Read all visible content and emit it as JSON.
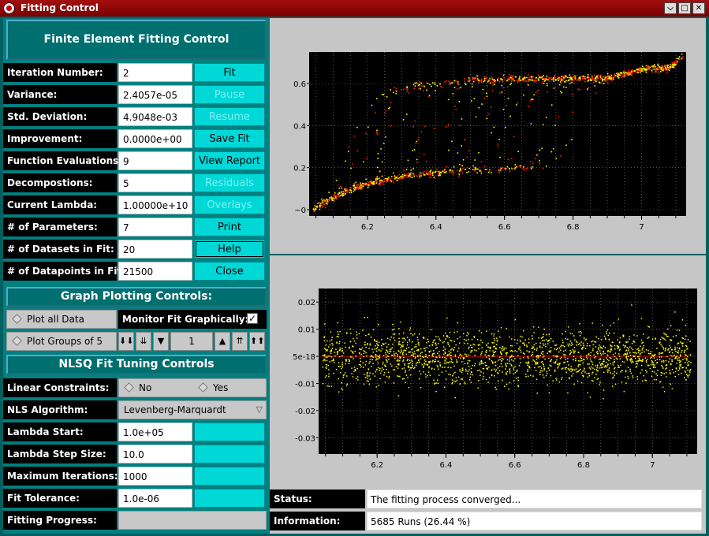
{
  "window": {
    "title": "Fitting Control"
  },
  "header": {
    "title": "Finite Element Fitting Control"
  },
  "stats": [
    {
      "label": "Iteration Number:",
      "value": "2",
      "button": "Fit",
      "enabled": true
    },
    {
      "label": "Variance:",
      "value": "2.4057e-05",
      "button": "Pause",
      "enabled": false
    },
    {
      "label": "Std. Deviation:",
      "value": "4.9048e-03",
      "button": "Resume",
      "enabled": false
    },
    {
      "label": "Improvement:",
      "value": "0.0000e+00",
      "button": "Save Fit",
      "enabled": true
    },
    {
      "label": "Function Evaluations:",
      "value": "9",
      "button": "View Report",
      "enabled": true
    },
    {
      "label": "Decompostions:",
      "value": "5",
      "button": "Residuals",
      "enabled": false
    },
    {
      "label": "Current Lambda:",
      "value": "1.00000e+10",
      "button": "Overlays",
      "enabled": false
    },
    {
      "label": "# of Parameters:",
      "value": "7",
      "button": "Print",
      "enabled": true
    },
    {
      "label": "# of Datasets in Fit:",
      "value": "20",
      "button": "Help",
      "enabled": true
    },
    {
      "label": "# of Datapoints in Fit:",
      "value": "21500",
      "button": "Close",
      "enabled": true
    }
  ],
  "graph_controls": {
    "title": "Graph Plotting Controls:",
    "plot_all": "Plot all Data",
    "plot_groups": "Plot Groups of 5",
    "monitor_label": "Monitor Fit Graphically:",
    "monitor_checked": true,
    "group_value": "1"
  },
  "nlsq": {
    "title": "NLSQ Fit Tuning Controls",
    "linear_constraints_label": "Linear Constraints:",
    "no_label": "No",
    "yes_label": "Yes",
    "algorithm_label": "NLS Algorithm:",
    "algorithm_value": "Levenberg-Marquardt",
    "lambda_start_label": "Lambda Start:",
    "lambda_start_value": "1.0e+05",
    "lambda_step_label": "Lambda Step Size:",
    "lambda_step_value": "10.0",
    "max_iter_label": "Maximum Iterations:",
    "max_iter_value": "1000",
    "fit_tol_label": "Fit Tolerance:",
    "fit_tol_value": "1.0e-06",
    "progress_label": "Fitting Progress:",
    "progress": 0
  },
  "status": {
    "status_label": "Status:",
    "status_value": "The fitting process converged...",
    "info_label": "Information:",
    "info_value": "5685 Runs (26.44 %)"
  },
  "chart_data": [
    {
      "type": "scatter",
      "title": "",
      "x_ticks": [
        "6.2",
        "6.4",
        "6.6",
        "6.8",
        "7"
      ],
      "y_ticks": [
        "0",
        "0.2",
        "0.4",
        "0.6"
      ],
      "xlim": [
        6.03,
        7.13
      ],
      "ylim": [
        -0.03,
        0.75
      ],
      "series": [
        {
          "curves": 20,
          "y_start": 0.0,
          "y_end": 0.67,
          "colors": [
            "#ffff00",
            "#ff2000"
          ]
        }
      ]
    },
    {
      "type": "scatter",
      "title": "",
      "x_ticks": [
        "6.2",
        "6.4",
        "6.6",
        "6.8",
        "7"
      ],
      "y_ticks": [
        "0.02",
        "0.01",
        "5e-18",
        "-0.01",
        "-0.02",
        "-0.03"
      ],
      "xlim": [
        6.03,
        7.13
      ],
      "ylim": [
        -0.036,
        0.025
      ],
      "series": [
        {
          "center": 0.0,
          "spread": 0.005,
          "color": "#ffff00"
        }
      ]
    }
  ]
}
